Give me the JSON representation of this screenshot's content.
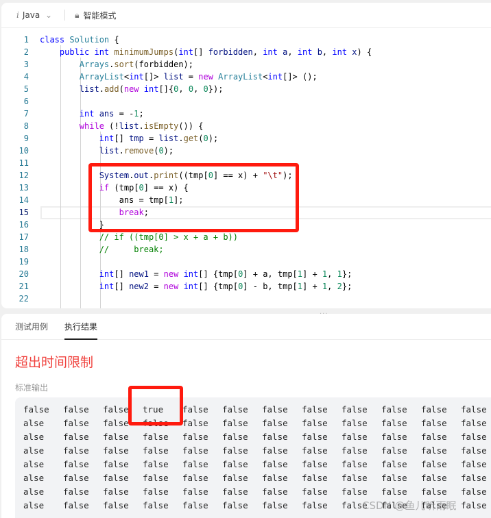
{
  "toolbar": {
    "language": "Java",
    "mode": "智能模式"
  },
  "code": [
    [
      [
        "kw",
        "class "
      ],
      [
        "ty",
        "Solution "
      ],
      [
        "pl",
        "{"
      ]
    ],
    [
      [
        "pl",
        "    "
      ],
      [
        "kw",
        "public int "
      ],
      [
        "fn",
        "minimumJumps"
      ],
      [
        "pl",
        "("
      ],
      [
        "kw",
        "int"
      ],
      [
        "pl",
        "[] "
      ],
      [
        "va",
        "forbidden"
      ],
      [
        "pl",
        ", "
      ],
      [
        "kw",
        "int "
      ],
      [
        "va",
        "a"
      ],
      [
        "pl",
        ", "
      ],
      [
        "kw",
        "int "
      ],
      [
        "va",
        "b"
      ],
      [
        "pl",
        ", "
      ],
      [
        "kw",
        "int "
      ],
      [
        "va",
        "x"
      ],
      [
        "pl",
        ") {"
      ]
    ],
    [
      [
        "pl",
        "        "
      ],
      [
        "ty",
        "Arrays"
      ],
      [
        "pl",
        "."
      ],
      [
        "fn",
        "sort"
      ],
      [
        "pl",
        "(forbidden);"
      ]
    ],
    [
      [
        "pl",
        "        "
      ],
      [
        "ty",
        "ArrayList"
      ],
      [
        "pl",
        "<"
      ],
      [
        "kw",
        "int"
      ],
      [
        "pl",
        "[]> "
      ],
      [
        "va",
        "list"
      ],
      [
        "pl",
        " = "
      ],
      [
        "pu",
        "new "
      ],
      [
        "ty",
        "ArrayList"
      ],
      [
        "pl",
        "<"
      ],
      [
        "kw",
        "int"
      ],
      [
        "pl",
        "[]> ();"
      ]
    ],
    [
      [
        "pl",
        "        "
      ],
      [
        "va",
        "list"
      ],
      [
        "pl",
        "."
      ],
      [
        "fn",
        "add"
      ],
      [
        "pl",
        "("
      ],
      [
        "pu",
        "new "
      ],
      [
        "kw",
        "int"
      ],
      [
        "pl",
        "[]{"
      ],
      [
        "nu",
        "0"
      ],
      [
        "pl",
        ", "
      ],
      [
        "nu",
        "0"
      ],
      [
        "pl",
        ", "
      ],
      [
        "nu",
        "0"
      ],
      [
        "pl",
        "});"
      ]
    ],
    [],
    [
      [
        "pl",
        "        "
      ],
      [
        "kw",
        "int "
      ],
      [
        "va",
        "ans"
      ],
      [
        "pl",
        " = -"
      ],
      [
        "nu",
        "1"
      ],
      [
        "pl",
        ";"
      ]
    ],
    [
      [
        "pl",
        "        "
      ],
      [
        "pu",
        "while "
      ],
      [
        "pl",
        "(!"
      ],
      [
        "va",
        "list"
      ],
      [
        "pl",
        "."
      ],
      [
        "fn",
        "isEmpty"
      ],
      [
        "pl",
        "()) {"
      ]
    ],
    [
      [
        "pl",
        "            "
      ],
      [
        "kw",
        "int"
      ],
      [
        "pl",
        "[] "
      ],
      [
        "va",
        "tmp"
      ],
      [
        "pl",
        " = "
      ],
      [
        "va",
        "list"
      ],
      [
        "pl",
        "."
      ],
      [
        "fn",
        "get"
      ],
      [
        "pl",
        "("
      ],
      [
        "nu",
        "0"
      ],
      [
        "pl",
        ");"
      ]
    ],
    [
      [
        "pl",
        "            "
      ],
      [
        "va",
        "list"
      ],
      [
        "pl",
        "."
      ],
      [
        "fn",
        "remove"
      ],
      [
        "pl",
        "("
      ],
      [
        "nu",
        "0"
      ],
      [
        "pl",
        ");"
      ]
    ],
    [],
    [
      [
        "pl",
        "            "
      ],
      [
        "va",
        "System"
      ],
      [
        "pl",
        "."
      ],
      [
        "va",
        "out"
      ],
      [
        "pl",
        "."
      ],
      [
        "fn",
        "print"
      ],
      [
        "pl",
        "((tmp["
      ],
      [
        "nu",
        "0"
      ],
      [
        "pl",
        "] == x) + "
      ],
      [
        "st",
        "\"\\t\""
      ],
      [
        "pl",
        ");"
      ]
    ],
    [
      [
        "pl",
        "            "
      ],
      [
        "pu",
        "if "
      ],
      [
        "pl",
        "(tmp["
      ],
      [
        "nu",
        "0"
      ],
      [
        "pl",
        "] == x) {"
      ]
    ],
    [
      [
        "pl",
        "                ans = tmp["
      ],
      [
        "nu",
        "1"
      ],
      [
        "pl",
        "];"
      ]
    ],
    [
      [
        "pl",
        "                "
      ],
      [
        "pu",
        "break"
      ],
      [
        "pl",
        ";"
      ]
    ],
    [
      [
        "pl",
        "            }"
      ]
    ],
    [
      [
        "pl",
        "            "
      ],
      [
        "cm",
        "// if ((tmp[0] > x + a + b))"
      ]
    ],
    [
      [
        "pl",
        "            "
      ],
      [
        "cm",
        "//     break;"
      ]
    ],
    [],
    [
      [
        "pl",
        "            "
      ],
      [
        "kw",
        "int"
      ],
      [
        "pl",
        "[] "
      ],
      [
        "va",
        "new1"
      ],
      [
        "pl",
        " = "
      ],
      [
        "pu",
        "new "
      ],
      [
        "kw",
        "int"
      ],
      [
        "pl",
        "[] {tmp["
      ],
      [
        "nu",
        "0"
      ],
      [
        "pl",
        "] + a, tmp["
      ],
      [
        "nu",
        "1"
      ],
      [
        "pl",
        "] + "
      ],
      [
        "nu",
        "1"
      ],
      [
        "pl",
        ", "
      ],
      [
        "nu",
        "1"
      ],
      [
        "pl",
        "};"
      ]
    ],
    [
      [
        "pl",
        "            "
      ],
      [
        "kw",
        "int"
      ],
      [
        "pl",
        "[] "
      ],
      [
        "va",
        "new2"
      ],
      [
        "pl",
        " = "
      ],
      [
        "pu",
        "new "
      ],
      [
        "kw",
        "int"
      ],
      [
        "pl",
        "[] {tmp["
      ],
      [
        "nu",
        "0"
      ],
      [
        "pl",
        "] - b, tmp["
      ],
      [
        "nu",
        "1"
      ],
      [
        "pl",
        "] + "
      ],
      [
        "nu",
        "1"
      ],
      [
        "pl",
        ", "
      ],
      [
        "nu",
        "2"
      ],
      [
        "pl",
        "};"
      ]
    ],
    []
  ],
  "current_line": 15,
  "tabs": [
    {
      "label": "测试用例"
    },
    {
      "label": "执行结果"
    }
  ],
  "result": {
    "status": "超出时间限制",
    "output_label": "标准输出"
  },
  "output_rows": [
    [
      "false",
      "false",
      "false",
      "true",
      "false",
      "false",
      "false",
      "false",
      "false",
      "false",
      "false",
      "false"
    ],
    [
      "alse",
      "false",
      "false",
      "false",
      "false",
      "false",
      "false",
      "false",
      "false",
      "false",
      "false",
      "false"
    ],
    [
      "alse",
      "false",
      "false",
      "false",
      "false",
      "false",
      "false",
      "false",
      "false",
      "false",
      "false",
      "false"
    ],
    [
      "alse",
      "false",
      "false",
      "false",
      "false",
      "false",
      "false",
      "false",
      "false",
      "false",
      "false",
      "false"
    ],
    [
      "alse",
      "false",
      "false",
      "false",
      "false",
      "false",
      "false",
      "false",
      "false",
      "false",
      "false",
      "false"
    ],
    [
      "alse",
      "false",
      "false",
      "false",
      "false",
      "false",
      "false",
      "false",
      "false",
      "false",
      "false",
      "false"
    ],
    [
      "alse",
      "false",
      "false",
      "false",
      "false",
      "false",
      "false",
      "false",
      "false",
      "false",
      "false",
      "false"
    ],
    [
      "alse",
      "false",
      "false",
      "false",
      "false",
      "false",
      "false",
      "false",
      "false",
      "false",
      "false",
      "false"
    ]
  ],
  "watermark": "CSDN @鱼儿听雨眠",
  "colors": {
    "status": "#f0433f",
    "annotation": "#ff1a0e"
  }
}
